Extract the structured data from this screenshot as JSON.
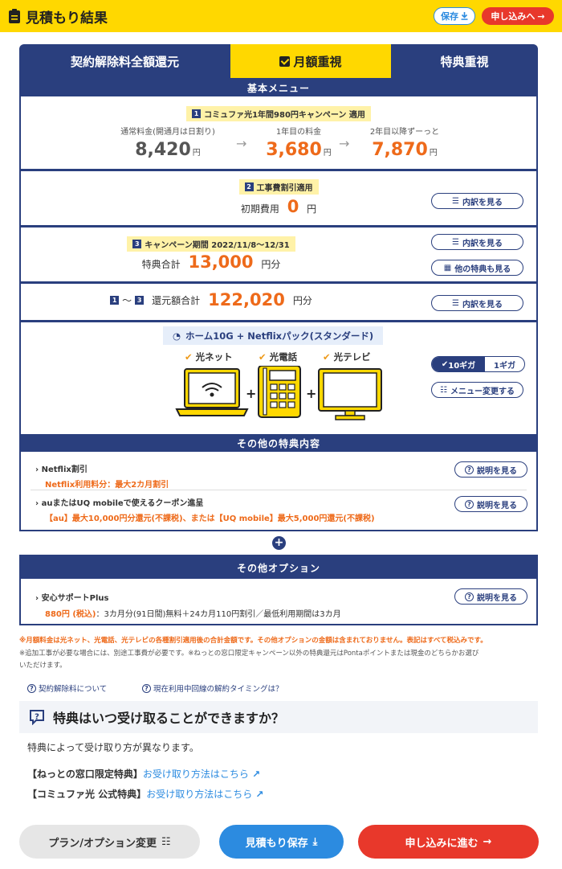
{
  "header": {
    "title": "見積もり結果",
    "save_label": "保存",
    "apply_label": "申し込みへ"
  },
  "tabs": [
    {
      "label": "契約解除料全額還元"
    },
    {
      "label": "月額重視",
      "selected": true
    },
    {
      "label": "特典重視"
    }
  ],
  "basic": {
    "band": "基本メニュー",
    "campaign_num": "1",
    "campaign_tag": "コミュファ光1年間980円キャンペーン 適用",
    "prices": [
      {
        "label": "通常料金(開通月は日割り)",
        "value": "8,420",
        "unit": "円"
      },
      {
        "label": "1年目の料金",
        "value": "3,680",
        "unit": "円"
      },
      {
        "label": "2年目以降ずーっと",
        "value": "7,870",
        "unit": "円"
      }
    ]
  },
  "construction": {
    "num": "2",
    "tag": "工事費割引適用",
    "label": "初期費用",
    "value": "0",
    "unit": "円",
    "button": "内訳を見る"
  },
  "campaign": {
    "num": "3",
    "tag": "キャンペーン期間 2022/11/8〜12/31",
    "label": "特典合計",
    "value": "13,000",
    "unit": "円分",
    "button1": "内訳を見る",
    "button2": "他の特典も見る"
  },
  "total": {
    "num_start": "1",
    "tilde": "〜",
    "num_end": "3",
    "label": "還元額合計",
    "value": "122,020",
    "unit": "円分",
    "button": "内訳を見る"
  },
  "pack": {
    "title": "ホーム10G + Netflixパック(スタンダード)",
    "services": [
      "光ネット",
      "光電話",
      "光テレビ"
    ],
    "speed_selected": "10ギガ",
    "speed_other": "1ギガ",
    "change_button": "メニュー変更する"
  },
  "other_benefits": {
    "band": "その他の特典内容",
    "items": [
      {
        "title": "Netflix割引",
        "detail": "Netflix利用料分：最大2カ月割引",
        "button": "説明を見る"
      },
      {
        "title": "auまたはUQ mobileで使えるクーポン進呈",
        "detail": "【au】最大10,000円分還元(不課税)、または【UQ mobile】最大5,000円還元(不課税)",
        "button": "説明を見る"
      }
    ]
  },
  "options": {
    "band": "その他オプション",
    "items": [
      {
        "title": "安心サポートPlus",
        "price": "880円 (税込)",
        "detail": "：3カ月分(91日間)無料＋24カ月110円割引／最低利用期間は3カ月",
        "button": "説明を見る"
      }
    ]
  },
  "notes": {
    "line1": "※月額料金は光ネット、光電話、光テレビの各種割引適用後の合計金額です。その他オプションの金額は含まれておりません。表記はすべて税込みです。",
    "line2": "※追加工事が必要な場合には、別途工事費が必要です。※ねっとの窓口限定キャンペーン以外の特典還元はPontaポイントまたは現金のどちらかお選び",
    "line3": "いただけます。"
  },
  "links": {
    "cancel_fee": "契約解除料について",
    "timing": "現在利用中回線の解約タイミングは？"
  },
  "faq": {
    "title": "特典はいつ受け取ることができますか？",
    "body": "特典によって受け取り方が異なります。",
    "rows": [
      {
        "label": "【ねっとの窓口限定特典】",
        "link": "お受け取り方法はこちら"
      },
      {
        "label": "【コミュファ光 公式特典】",
        "link": "お受け取り方法はこちら"
      }
    ]
  },
  "footer": {
    "change": "プラン/オプション変更",
    "save": "見積もり保存",
    "apply": "申し込みに進む"
  },
  "colors": {
    "brand_yellow": "#ffd800",
    "navy": "#2a3f7e",
    "accent_orange": "#ee6a1a",
    "apply_red": "#e8382b",
    "save_blue": "#2c8be0"
  }
}
